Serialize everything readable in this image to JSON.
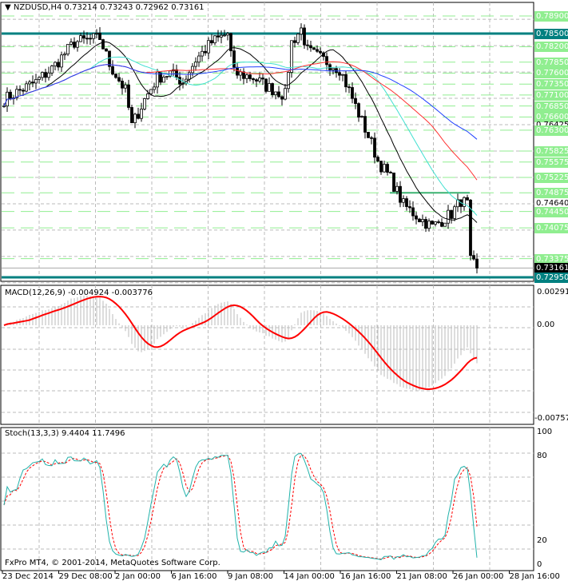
{
  "header": {
    "symbol": "NZDUSD,H4",
    "open": "0.73214",
    "high": "0.73243",
    "low": "0.72962",
    "close": "0.73161"
  },
  "price_axis": {
    "levels": [
      "0.78900",
      "0.78500",
      "0.78200",
      "0.77850",
      "0.77600",
      "0.77350",
      "0.77100",
      "0.76850",
      "0.76600",
      "0.76425",
      "0.76300",
      "0.75825",
      "0.75575",
      "0.75225",
      "0.74875",
      "0.74640",
      "0.74450",
      "0.74075",
      "0.73375",
      "0.73161",
      "0.72950"
    ],
    "green_levels": [
      0.789,
      0.782,
      0.7785,
      0.776,
      0.7735,
      0.771,
      0.7685,
      0.766,
      0.763,
      0.75825,
      0.75575,
      0.75225,
      0.74875,
      0.7445,
      0.74075,
      0.73375
    ],
    "teal_levels": [
      0.785,
      0.7295
    ],
    "current": 0.73161,
    "plain": [
      0.7464,
      0.76425
    ]
  },
  "macd": {
    "label": "MACD(12,26,9) -0.004924 -0.003776",
    "axis": [
      "0.002913",
      "0.00",
      "-0.007571"
    ]
  },
  "stoch": {
    "label": "Stoch(13,3,3) 9.4404 11.7496",
    "axis": [
      "100",
      "80",
      "20",
      "0"
    ]
  },
  "copyright": "FxPro MT4, © 2001-2014, MetaQuotes Software Corp.",
  "time_axis": [
    "23 Dec 2014",
    "29 Dec 08:00",
    "2 Jan 00:00",
    "6 Jan 16:00",
    "9 Jan 08:00",
    "14 Jan 00:00",
    "16 Jan 16:00",
    "21 Jan 08:00",
    "26 Jan 00:00",
    "28 Jan 16:00"
  ],
  "colors": {
    "up": "#000",
    "green": "#90ee90",
    "teal": "#008080",
    "macd_signal": "#ff0000",
    "stoch_main": "#20b2aa"
  },
  "chart_data": {
    "type": "candlestick",
    "symbol": "NZDUSD",
    "timeframe": "H4",
    "path": [
      [
        0,
        0.77
      ],
      [
        10,
        0.774
      ],
      [
        15,
        0.777
      ],
      [
        22,
        0.783
      ],
      [
        30,
        0.784
      ],
      [
        33,
        0.778
      ],
      [
        38,
        0.772
      ],
      [
        40,
        0.764
      ],
      [
        44,
        0.77
      ],
      [
        48,
        0.775
      ],
      [
        52,
        0.776
      ],
      [
        56,
        0.774
      ],
      [
        60,
        0.779
      ],
      [
        65,
        0.783
      ],
      [
        70,
        0.785
      ],
      [
        72,
        0.776
      ],
      [
        78,
        0.775
      ],
      [
        82,
        0.773
      ],
      [
        88,
        0.771
      ],
      [
        90,
        0.783
      ],
      [
        93,
        0.786
      ],
      [
        95,
        0.781
      ],
      [
        100,
        0.779
      ],
      [
        105,
        0.777
      ],
      [
        108,
        0.772
      ],
      [
        112,
        0.765
      ],
      [
        115,
        0.76
      ],
      [
        117,
        0.756
      ],
      [
        121,
        0.752
      ],
      [
        125,
        0.746
      ],
      [
        130,
        0.743
      ],
      [
        134,
        0.741
      ],
      [
        140,
        0.744
      ],
      [
        143,
        0.747
      ],
      [
        145,
        0.746
      ],
      [
        146,
        0.733
      ],
      [
        148,
        0.7316
      ]
    ],
    "ylim": [
      0.7285,
      0.7905
    ]
  }
}
